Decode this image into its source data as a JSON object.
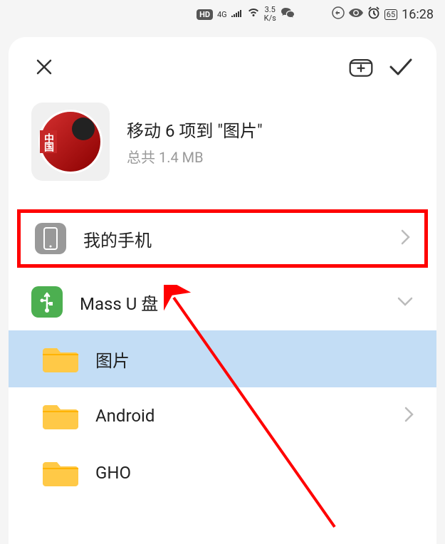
{
  "statusbar": {
    "hd": "HD",
    "network_4g": "4G",
    "speed_value": "3.5",
    "speed_unit": "K/s",
    "battery": "65",
    "time": "16:28"
  },
  "sheet": {
    "title": "移动 6 项到 \"图片\"",
    "subtitle": "总共 1.4 MB"
  },
  "list_items": {
    "phone": "我的手机",
    "usb": "Mass U 盘",
    "folder1": "图片",
    "folder2": "Android",
    "folder3": "GHO"
  }
}
